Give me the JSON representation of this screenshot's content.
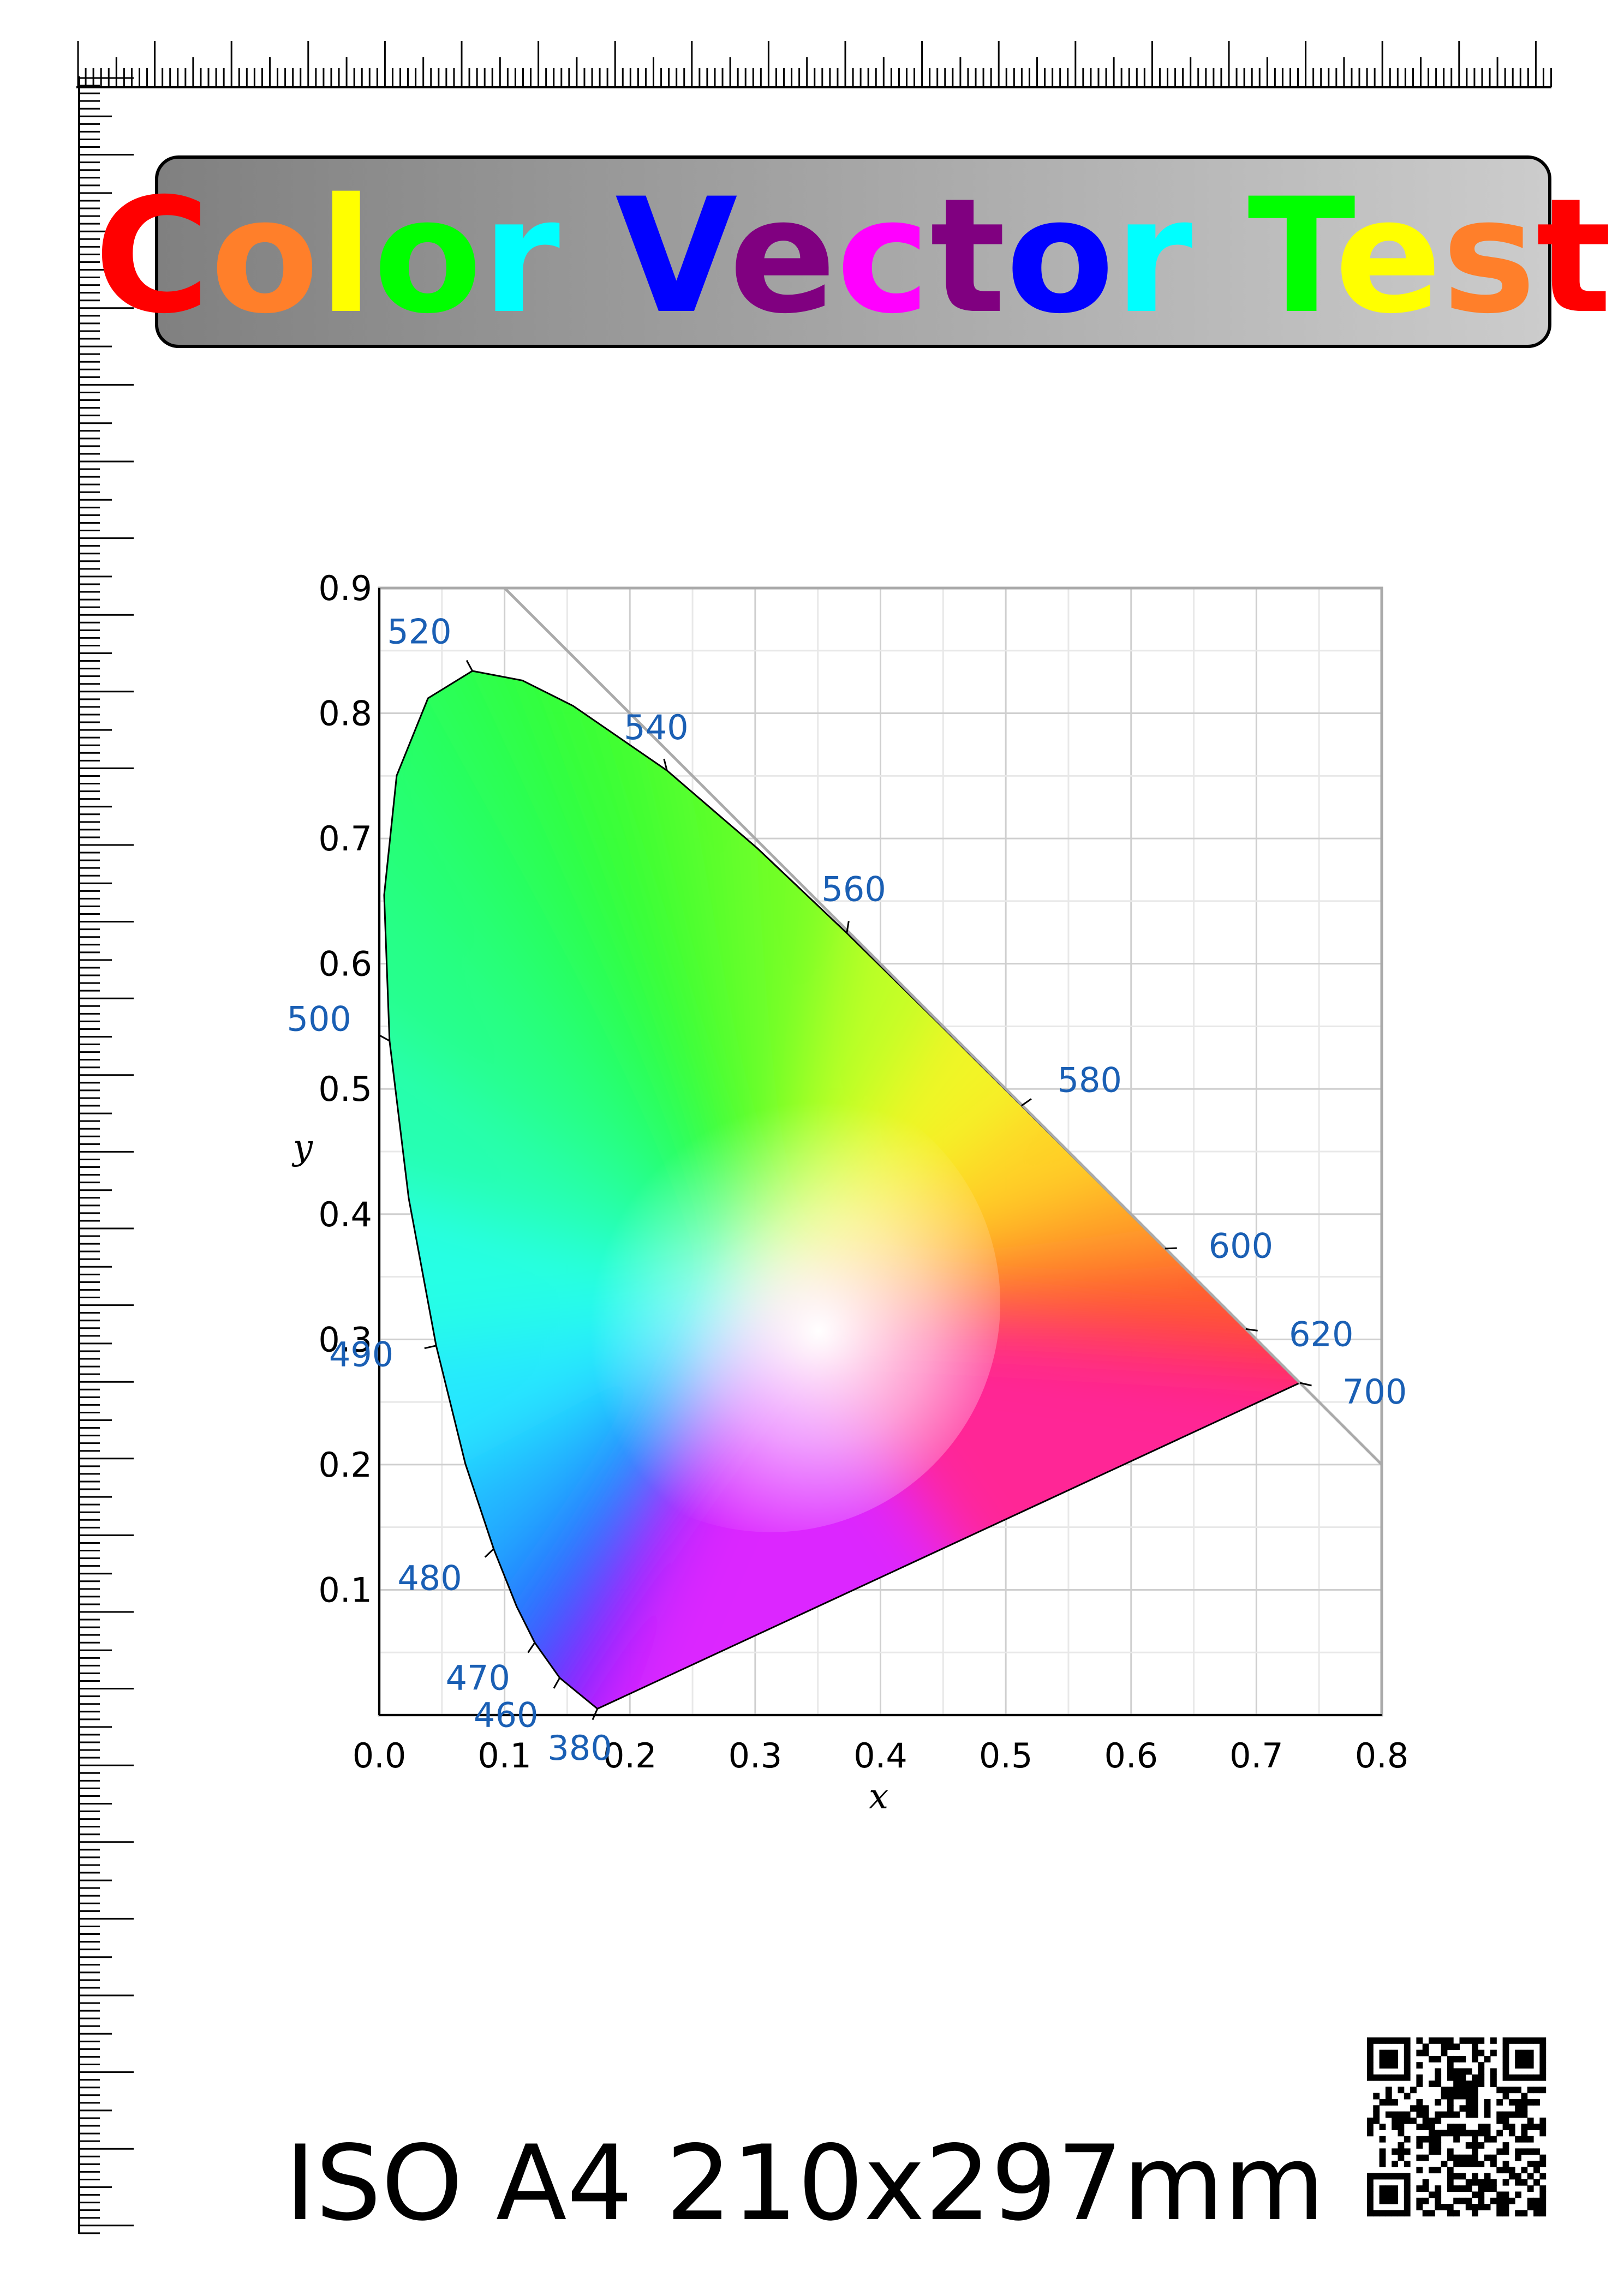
{
  "title": {
    "letters": [
      {
        "ch": "C",
        "color": "#ff0000"
      },
      {
        "ch": "o",
        "color": "#ff7f2a"
      },
      {
        "ch": "l",
        "color": "#ffff00"
      },
      {
        "ch": "o",
        "color": "#00ff00"
      },
      {
        "ch": "r",
        "color": "#00ffff"
      },
      {
        "ch": " ",
        "color": "#000000"
      },
      {
        "ch": "V",
        "color": "#0000ff"
      },
      {
        "ch": "e",
        "color": "#800080"
      },
      {
        "ch": "c",
        "color": "#ff00ff"
      },
      {
        "ch": "t",
        "color": "#800080"
      },
      {
        "ch": "o",
        "color": "#0000ff"
      },
      {
        "ch": "r",
        "color": "#00ffff"
      },
      {
        "ch": " ",
        "color": "#000000"
      },
      {
        "ch": "T",
        "color": "#00ff00"
      },
      {
        "ch": "e",
        "color": "#ffff00"
      },
      {
        "ch": "s",
        "color": "#ff7f2a"
      },
      {
        "ch": "t",
        "color": "#ff0000"
      }
    ],
    "banner_gradient": [
      "#808080",
      "#cccccc"
    ]
  },
  "chart_data": {
    "type": "scatter",
    "title": "",
    "xlabel": "x",
    "ylabel": "y",
    "xlim": [
      0,
      0.8
    ],
    "ylim": [
      0,
      0.9
    ],
    "xticks": [
      "0.0",
      "0.1",
      "0.2",
      "0.3",
      "0.4",
      "0.5",
      "0.6",
      "0.7",
      "0.8"
    ],
    "yticks": [
      "0.1",
      "0.2",
      "0.3",
      "0.4",
      "0.5",
      "0.6",
      "0.7",
      "0.8",
      "0.9"
    ],
    "grid": true,
    "label_color": "#1a5fb4",
    "spectral_locus": [
      {
        "wl": 380,
        "x": 0.1741,
        "y": 0.005,
        "label": "380"
      },
      {
        "wl": 460,
        "x": 0.144,
        "y": 0.0297,
        "label": "460"
      },
      {
        "wl": 470,
        "x": 0.1241,
        "y": 0.0578,
        "label": "470"
      },
      {
        "wl": 475,
        "x": 0.1096,
        "y": 0.0868,
        "label": ""
      },
      {
        "wl": 480,
        "x": 0.0913,
        "y": 0.1327,
        "label": "480"
      },
      {
        "wl": 485,
        "x": 0.0687,
        "y": 0.2007,
        "label": ""
      },
      {
        "wl": 490,
        "x": 0.0454,
        "y": 0.295,
        "label": "490"
      },
      {
        "wl": 495,
        "x": 0.0235,
        "y": 0.4127,
        "label": ""
      },
      {
        "wl": 500,
        "x": 0.0082,
        "y": 0.5384,
        "label": "500"
      },
      {
        "wl": 505,
        "x": 0.0039,
        "y": 0.6548,
        "label": ""
      },
      {
        "wl": 510,
        "x": 0.0139,
        "y": 0.7502,
        "label": ""
      },
      {
        "wl": 515,
        "x": 0.0389,
        "y": 0.812,
        "label": ""
      },
      {
        "wl": 520,
        "x": 0.0743,
        "y": 0.8338,
        "label": "520"
      },
      {
        "wl": 525,
        "x": 0.1142,
        "y": 0.8262,
        "label": ""
      },
      {
        "wl": 530,
        "x": 0.1547,
        "y": 0.8059,
        "label": ""
      },
      {
        "wl": 540,
        "x": 0.2296,
        "y": 0.7543,
        "label": "540"
      },
      {
        "wl": 550,
        "x": 0.3016,
        "y": 0.6923,
        "label": ""
      },
      {
        "wl": 560,
        "x": 0.3731,
        "y": 0.6245,
        "label": "560"
      },
      {
        "wl": 570,
        "x": 0.4441,
        "y": 0.5547,
        "label": ""
      },
      {
        "wl": 580,
        "x": 0.5125,
        "y": 0.4866,
        "label": "580"
      },
      {
        "wl": 590,
        "x": 0.5752,
        "y": 0.4242,
        "label": ""
      },
      {
        "wl": 600,
        "x": 0.627,
        "y": 0.3725,
        "label": "600"
      },
      {
        "wl": 620,
        "x": 0.6915,
        "y": 0.3083,
        "label": "620"
      },
      {
        "wl": 700,
        "x": 0.7347,
        "y": 0.2653,
        "label": "700"
      }
    ],
    "reference_line": [
      [
        0.1,
        0.9
      ],
      [
        0.8,
        0.2
      ]
    ]
  },
  "footer": {
    "text": "ISO A4 210x297mm"
  }
}
